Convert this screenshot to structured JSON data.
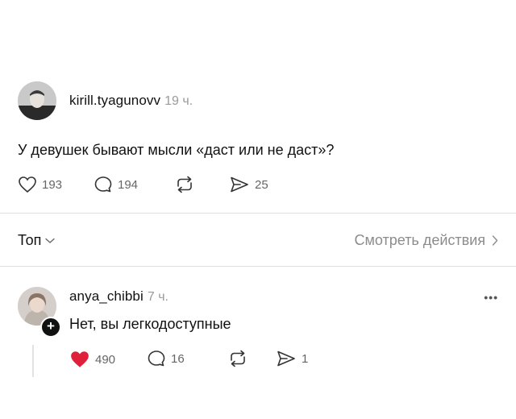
{
  "post": {
    "username": "kirill.tyagunovv",
    "time": "19 ч.",
    "text": "У девушек бывают мысли «даст или не даст»?",
    "likes": "193",
    "comments": "194",
    "shares": "25"
  },
  "controls": {
    "sort_label": "Топ",
    "view_actions_label": "Смотреть действия"
  },
  "reply": {
    "username": "anya_chibbi",
    "time": "7 ч.",
    "text": "Нет, вы легкодоступные",
    "more": "•••",
    "likes": "490",
    "comments": "16",
    "shares": "1",
    "liked_color": "#e0203a"
  }
}
